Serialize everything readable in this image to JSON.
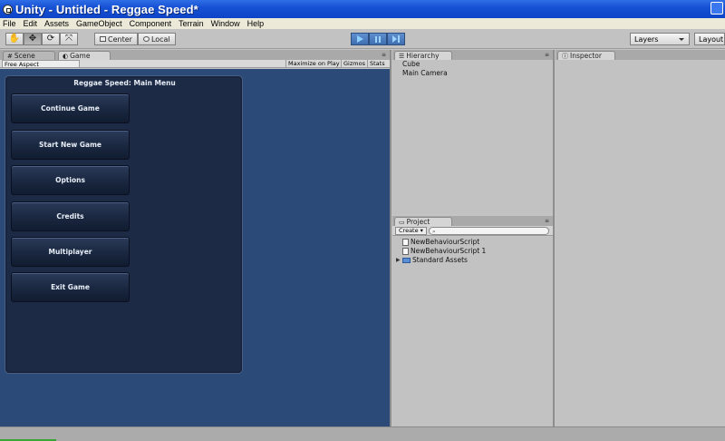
{
  "window": {
    "title": "Unity - Untitled - Reggae Speed*"
  },
  "menubar": {
    "items": [
      "File",
      "Edit",
      "Assets",
      "GameObject",
      "Component",
      "Terrain",
      "Window",
      "Help"
    ]
  },
  "toolbar": {
    "pivot_label": "Center",
    "space_label": "Local",
    "layers_label": "Layers",
    "layout_label": "Layout"
  },
  "scene_tabs": {
    "scene": "Scene",
    "game": "Game"
  },
  "game_bar": {
    "aspect": "Free Aspect",
    "maximize": "Maximize on Play",
    "gizmos": "Gizmos",
    "stats": "Stats"
  },
  "game_menu": {
    "title": "Reggae Speed: Main Menu",
    "buttons": [
      "Continue Game",
      "Start New Game",
      "Options",
      "Credits",
      "Multiplayer",
      "Exit Game"
    ]
  },
  "hierarchy": {
    "tab": "Hierarchy",
    "items": [
      "Cube",
      "Main Camera"
    ]
  },
  "project": {
    "tab": "Project",
    "create_label": "Create",
    "items": [
      "NewBehaviourScript",
      "NewBehaviourScript 1",
      "Standard Assets"
    ]
  },
  "inspector": {
    "tab": "Inspector"
  },
  "colors": {
    "game_background": "#2b4a78",
    "menu_panel": "#1c2a45",
    "titlebar": "#1651d4",
    "play_active": "#3f6fb0"
  },
  "icons": [
    "hand-icon",
    "move-icon",
    "rotate-icon",
    "scale-icon",
    "play-icon",
    "pause-icon",
    "step-icon",
    "folder-icon",
    "script-icon",
    "search-icon",
    "info-icon"
  ]
}
